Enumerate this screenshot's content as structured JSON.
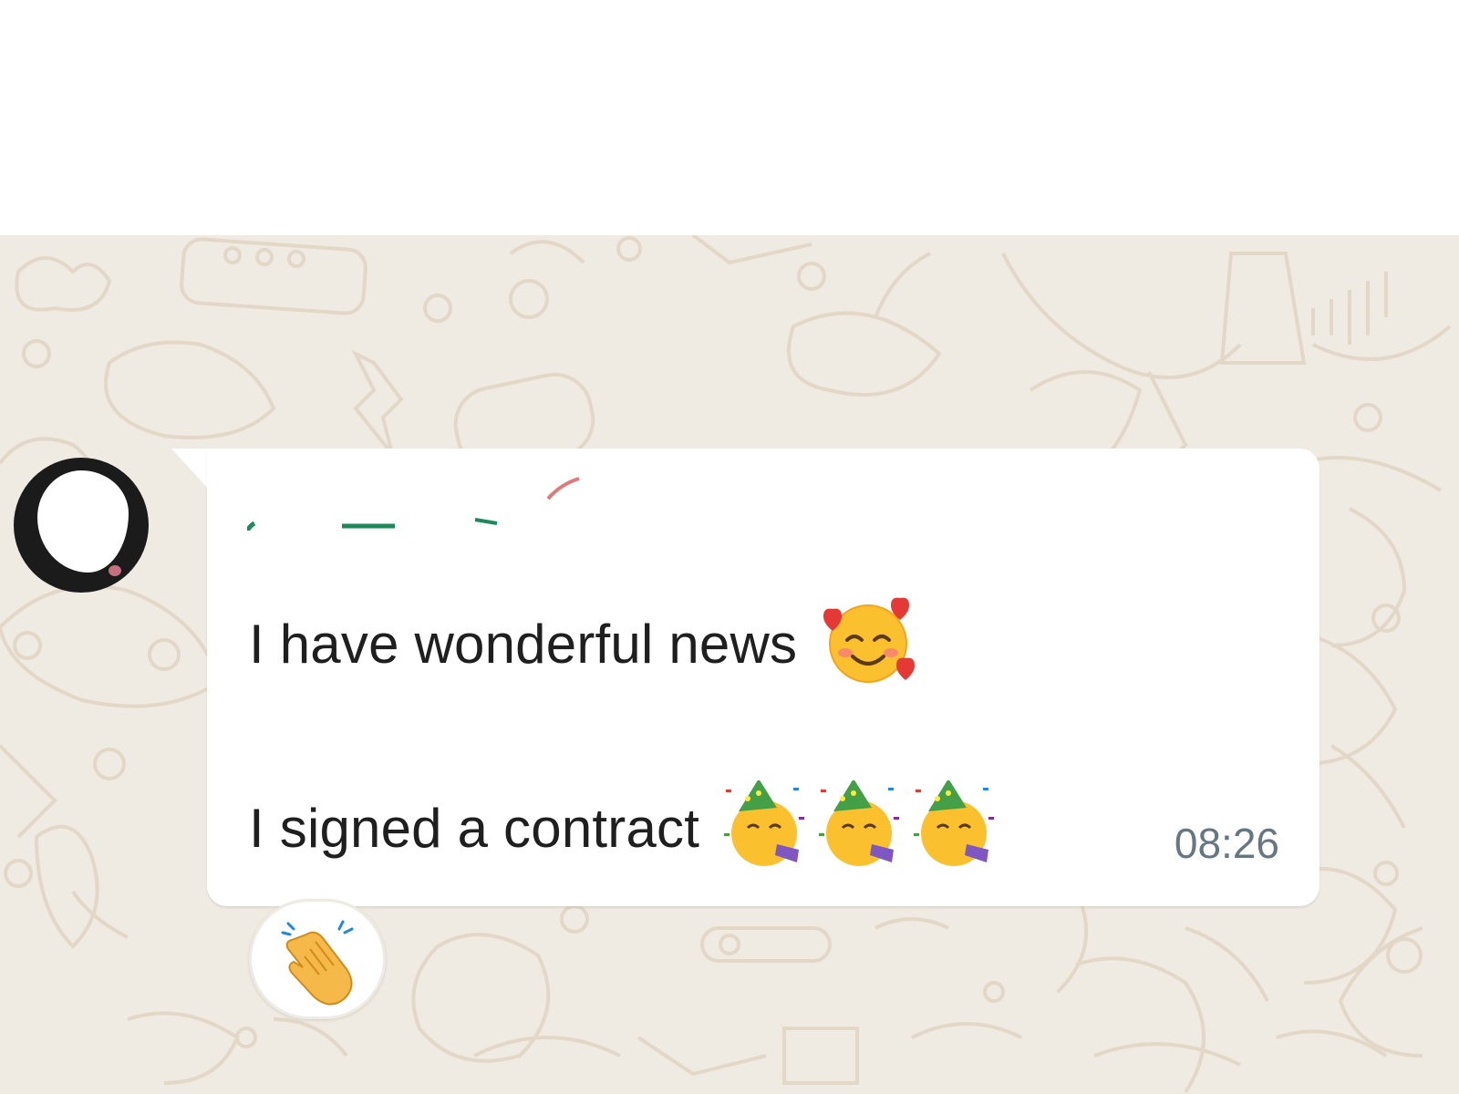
{
  "chat": {
    "message": {
      "line1": "I have wonderful news",
      "line1_emoji": "smiling-face-with-hearts-icon",
      "line2": "I signed a contract",
      "line2_emojis": [
        "partying-face-icon",
        "partying-face-icon",
        "partying-face-icon"
      ],
      "time": "08:26"
    },
    "reaction": {
      "emoji": "clapping-hands-icon"
    }
  },
  "colors": {
    "chat_background": "#efeae2",
    "bubble": "#ffffff",
    "text": "#1f1f1f",
    "timestamp": "#667781"
  }
}
